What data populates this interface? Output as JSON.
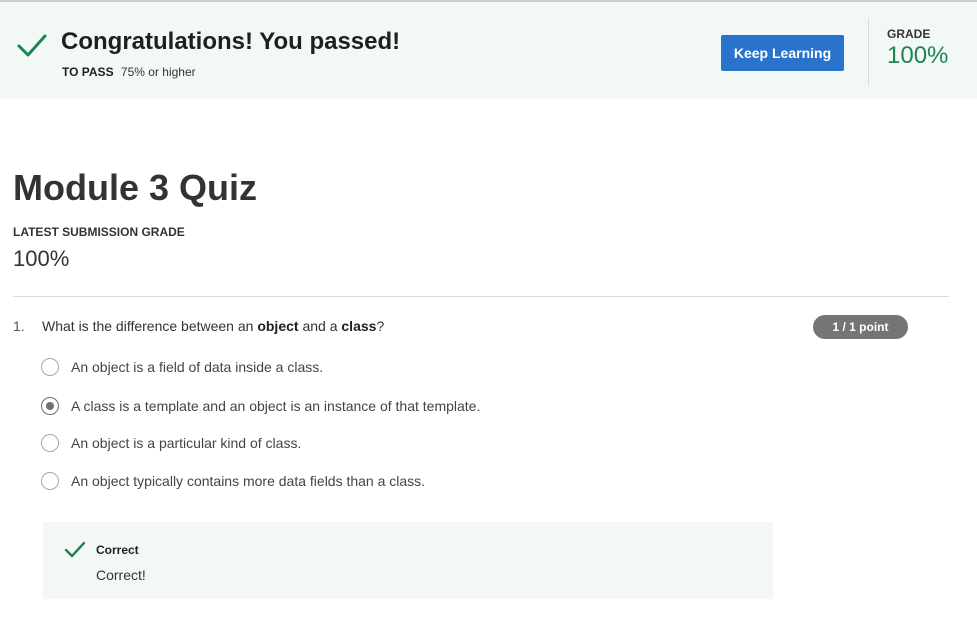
{
  "banner": {
    "title": "Congratulations! You passed!",
    "to_pass_label": "TO PASS",
    "to_pass_value": "75% or higher",
    "button_label": "Keep Learning",
    "grade_label": "GRADE",
    "grade_value": "100%"
  },
  "quiz": {
    "title": "Module 3 Quiz",
    "latest_label": "LATEST SUBMISSION GRADE",
    "latest_value": "100%"
  },
  "question": {
    "number": "1.",
    "text_parts": [
      "What is the difference between an ",
      "object",
      " and a ",
      "class",
      "?"
    ],
    "points": "1 / 1 point",
    "options": [
      {
        "label": "An object is a field of data inside a class.",
        "selected": false
      },
      {
        "label": "A class is a template and an object is an instance of that template.",
        "selected": true
      },
      {
        "label": "An object is a particular kind of class.",
        "selected": false
      },
      {
        "label": "An object typically contains more data fields than a class.",
        "selected": false
      }
    ],
    "feedback": {
      "title": "Correct",
      "text": "Correct!"
    }
  },
  "colors": {
    "success_green": "#1f8354",
    "button_blue": "#2a73cc",
    "banner_bg": "#f2f8f6"
  }
}
